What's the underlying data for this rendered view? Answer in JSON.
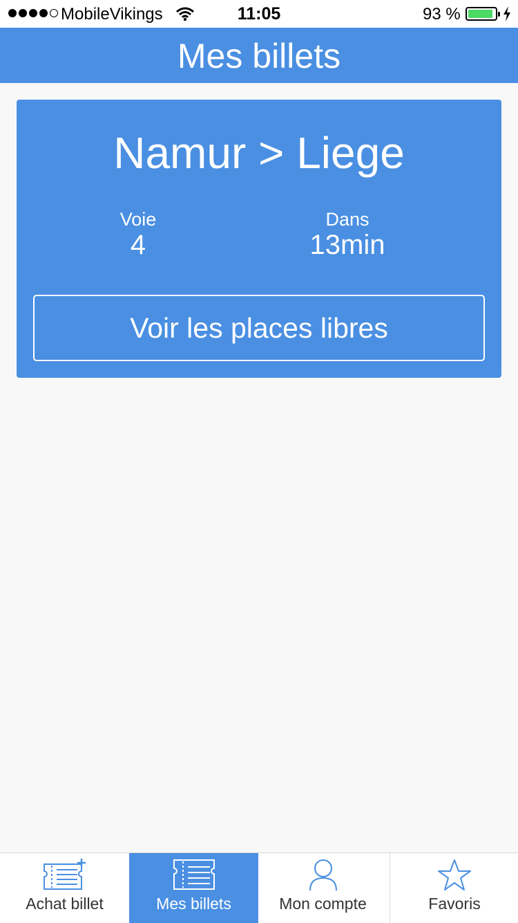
{
  "status_bar": {
    "carrier": "MobileVikings",
    "time": "11:05",
    "battery": "93 %"
  },
  "header": {
    "title": "Mes billets"
  },
  "ticket": {
    "route": "Namur > Liege",
    "platform_label": "Voie",
    "platform_value": "4",
    "departure_label": "Dans",
    "departure_value": "13min",
    "seats_button_label": "Voir les places libres"
  },
  "tab_bar": {
    "active_tab": "Mes billets",
    "tabs": [
      {
        "label": "Achat billet",
        "icon": "ticket-plus-icon"
      },
      {
        "label": "Mes billets",
        "icon": "ticket-icon"
      },
      {
        "label": "Mon compte",
        "icon": "user-icon"
      },
      {
        "label": "Favoris",
        "icon": "star-icon"
      }
    ]
  },
  "colors": {
    "accent": "#4a8fe2",
    "background": "#f8f8f8",
    "battery_fill": "#4cd964"
  }
}
